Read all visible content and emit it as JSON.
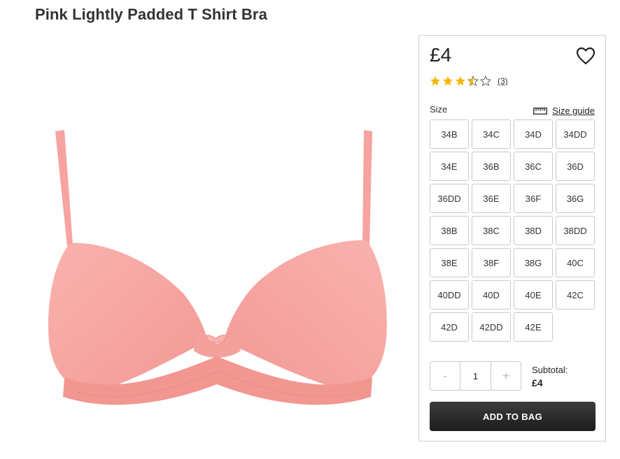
{
  "product": {
    "title": "Pink Lightly Padded T Shirt Bra",
    "price": "£4",
    "rating": {
      "value": 3.5,
      "max": 5,
      "count_label": "(3)"
    },
    "image_icon": "pink-bra-image"
  },
  "size_selector": {
    "label": "Size",
    "guide_label": "Size guide",
    "guide_icon": "ruler-icon",
    "sizes": [
      "34B",
      "34C",
      "34D",
      "34DD",
      "34E",
      "36B",
      "36C",
      "36D",
      "36DD",
      "36E",
      "36F",
      "36G",
      "38B",
      "38C",
      "38D",
      "38DD",
      "38E",
      "38F",
      "38G",
      "40C",
      "40DD",
      "40D",
      "40E",
      "42C",
      "42D",
      "42DD",
      "42E"
    ]
  },
  "quantity": {
    "minus": "-",
    "value": "1",
    "plus": "+"
  },
  "subtotal": {
    "label": "Subtotal:",
    "value": "£4"
  },
  "actions": {
    "add_to_bag": "ADD TO BAG",
    "wishlist_icon": "heart-icon"
  },
  "colors": {
    "star": "#f5b800",
    "button_dark": "#222222",
    "product_pink": "#f6a3a0"
  }
}
